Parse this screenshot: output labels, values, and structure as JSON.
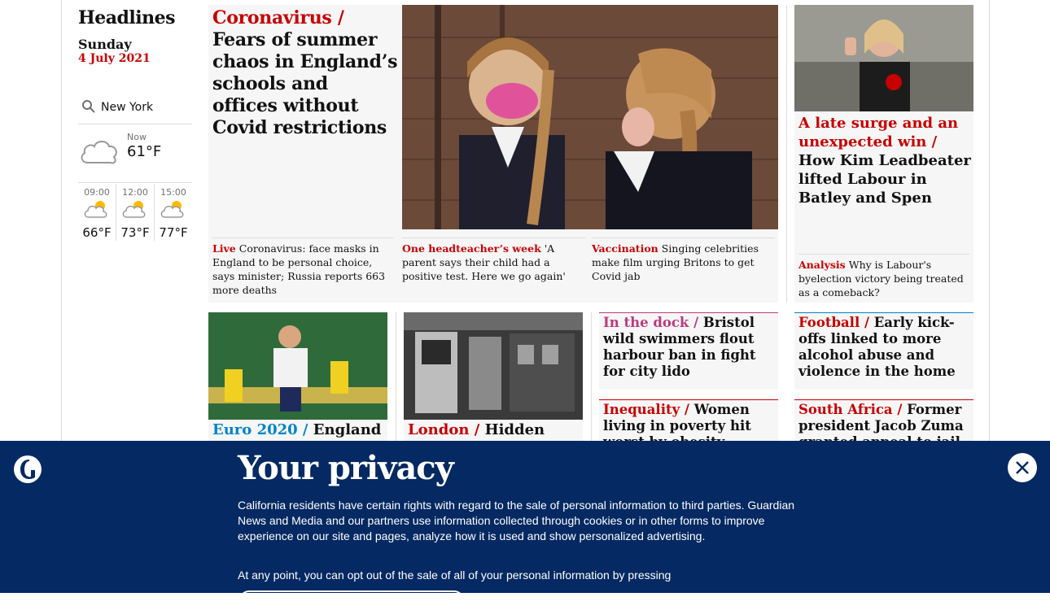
{
  "sidebar": {
    "title": "Headlines",
    "day": "Sunday",
    "date": "4 July 2021",
    "weather": {
      "location": "New York",
      "now_label": "Now",
      "now_temp": "61°F",
      "forecast": [
        {
          "time": "09:00",
          "temp": "66°F"
        },
        {
          "time": "12:00",
          "temp": "73°F"
        },
        {
          "time": "15:00",
          "temp": "77°F"
        }
      ]
    }
  },
  "main": {
    "kicker": "Coronavirus /",
    "headline": "Fears of summer chaos in England’s schools and offices without Covid restrictions",
    "subs": [
      {
        "kicker": "Live",
        "text": "Coronavirus: face masks in England to be personal choice, says minister; Russia reports 663 more deaths"
      },
      {
        "kicker": "One headteacher’s week",
        "text": "'A parent says their child had a positive test. Here we go again'"
      },
      {
        "kicker": "Vaccination",
        "text": "Singing celebrities make film urging Britons to get Covid jab"
      }
    ]
  },
  "right_top": {
    "kicker": "A late surge and an unexpected win /",
    "headline": "How Kim Leadbeater lifted Labour in Batley and Spen",
    "sub_kicker": "Analysis",
    "sub_text": "Why is Labour's byelection victory being treated as a comeback?"
  },
  "row2": {
    "euro": {
      "kicker": "Euro 2020 /",
      "headline": "England"
    },
    "london": {
      "kicker": "London /",
      "headline": "Hidden tram"
    },
    "dock": {
      "kicker": "In the dock /",
      "headline": "Bristol wild swimmers flout harbour ban in fight for city lido"
    },
    "inequality": {
      "kicker": "Inequality /",
      "headline": "Women living in poverty hit worst by obesity crisis, report finds"
    },
    "football": {
      "kicker": "Football /",
      "headline": "Early kick-offs linked to more alcohol abuse and violence in the home"
    },
    "south_africa": {
      "kicker": "South Africa /",
      "headline": "Former president Jacob Zuma granted appeal to jail"
    }
  },
  "privacy": {
    "title": "Your privacy",
    "body": "California residents have certain rights with regard to the sale of personal information to third parties. Guardian News and Media and our partners use information collected through cookies or in other forms to improve experience on our site and pages, analyze how it is used and show personalized advertising.",
    "body2": "At any point, you can opt out of the sale of all of your personal information by pressing"
  },
  "colors": {
    "news_red": "#c70000",
    "sport_blue": "#0084c6",
    "lifestyle_pink": "#bb3b80",
    "privacy_bg": "#052962"
  }
}
